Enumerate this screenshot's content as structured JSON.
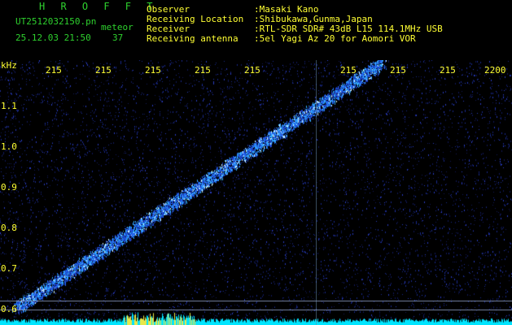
{
  "header": {
    "app_title": "H R O F F T",
    "file_name": "UT2512032150.pn",
    "tag": "meteor",
    "date_time": "25.12.03 21:50",
    "counter": "37",
    "fields": [
      {
        "label": "Observer",
        "value": ":Masaki Kano"
      },
      {
        "label": "Receiving Location",
        "value": ":Shibukawa,Gunma,Japan"
      },
      {
        "label": "Receiver",
        "value": ":RTL-SDR SDR# 43dB L15 114.1MHz USB"
      },
      {
        "label": "Receiving antenna",
        "value": ":5el Yagi Az 20 for Aomori VOR"
      }
    ]
  },
  "x_axis": {
    "ticks": [
      "215",
      "215",
      "215",
      "215",
      "215",
      "",
      "215",
      "215",
      "215",
      "2200"
    ]
  },
  "y_axis": {
    "unit": "kHz",
    "ticks": [
      "1.1",
      "1.0",
      "0.9",
      "0.8",
      "0.7",
      "0.6"
    ]
  },
  "colors": {
    "background": "#000000",
    "header_text": "#2ed12e",
    "axis_text": "#ffff33",
    "noise": "#1a2a8c",
    "signal": "#33aaff",
    "spectrum": "#00e5ff"
  }
}
